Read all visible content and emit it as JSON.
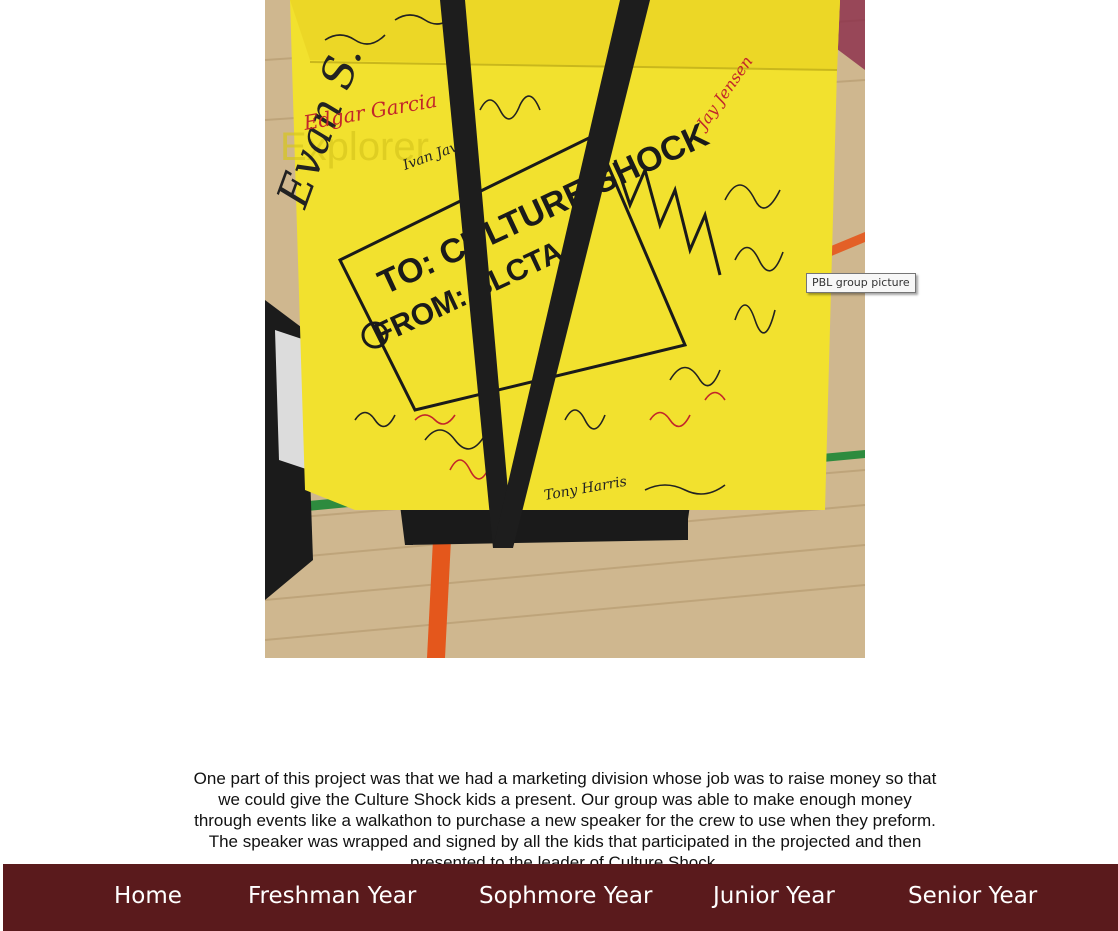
{
  "photo": {
    "tooltip": "PBL group picture",
    "drawing_labels": {
      "to_text": "TO: CULTURE SHOCK",
      "from_text": "FROM: SLCTA"
    },
    "signatures": [
      "Evan S.",
      "Edgar Garcia",
      "Ivan Javier",
      "Jay Jensen",
      "Tony Harris"
    ]
  },
  "content": {
    "paragraph": "One part of this project was that we had a marketing division whose job was to raise money so that we could give the Culture Shock kids a present. Our group was able to make enough money through events like a walkathon to purchase a new speaker for the crew to use when they preform. The speaker was wrapped and signed by all the kids that participated in the projected and then presented to the leader of Culture Shock."
  },
  "nav": {
    "items": [
      {
        "label": "Home"
      },
      {
        "label": "Freshman Year"
      },
      {
        "label": "Sophmore Year"
      },
      {
        "label": "Junior Year"
      },
      {
        "label": "Senior Year"
      }
    ]
  },
  "colors": {
    "nav_background": "#5a1a1c",
    "nav_text": "#ffffff",
    "wrap_yellow": "#f2e12e",
    "strap": "#1d1d1d"
  }
}
